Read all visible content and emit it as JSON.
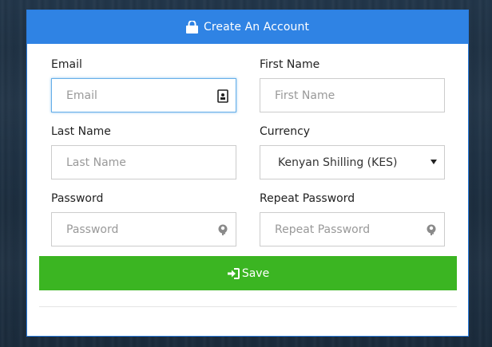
{
  "header": {
    "title": "Create An Account",
    "icon": "lock-icon"
  },
  "fields": {
    "email": {
      "label": "Email",
      "placeholder": "Email",
      "value": "",
      "icon": "contact-card-icon"
    },
    "first_name": {
      "label": "First Name",
      "placeholder": "First Name",
      "value": ""
    },
    "last_name": {
      "label": "Last Name",
      "placeholder": "Last Name",
      "value": ""
    },
    "currency": {
      "label": "Currency",
      "selected": "Kenyan Shilling (KES)",
      "icon": "caret-down-icon"
    },
    "password": {
      "label": "Password",
      "placeholder": "Password",
      "value": "",
      "icon": "key-icon"
    },
    "repeat_password": {
      "label": "Repeat Password",
      "placeholder": "Repeat Password",
      "value": "",
      "icon": "key-icon"
    }
  },
  "actions": {
    "save_label": "Save",
    "save_icon": "sign-in-icon"
  },
  "colors": {
    "header_bg": "#2f83e4",
    "save_bg": "#3bb522",
    "focus_border": "#66afe9",
    "page_bg": "#1e3042"
  }
}
